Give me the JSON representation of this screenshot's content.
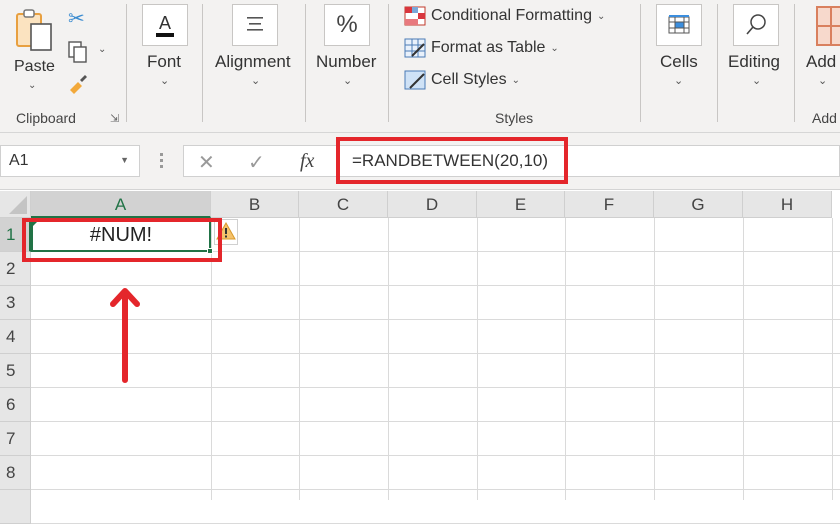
{
  "ribbon": {
    "groups": [
      {
        "name": "Clipboard",
        "buttons": [
          "Paste"
        ]
      },
      {
        "name": "Font",
        "label": "Font"
      },
      {
        "name": "Alignment",
        "label": "Alignment"
      },
      {
        "name": "Number",
        "label": "Number"
      },
      {
        "name": "Styles",
        "items": [
          "Conditional Formatting",
          "Format as Table",
          "Cell Styles"
        ]
      },
      {
        "name": "Cells",
        "label": "Cells"
      },
      {
        "name": "Editing",
        "label": "Editing"
      },
      {
        "name": "Add",
        "label": "Add"
      }
    ],
    "clipboard_label": "Clipboard",
    "paste_label": "Paste",
    "font_label": "Font",
    "alignment_label": "Alignment",
    "number_label": "Number",
    "cond_format_label": "Conditional Formatting",
    "format_table_label": "Format as Table",
    "cell_styles_label": "Cell Styles",
    "styles_label": "Styles",
    "cells_label": "Cells",
    "editing_label": "Editing",
    "addins_label": "Add",
    "addins_group_label": "Add"
  },
  "formula_bar": {
    "name_box": "A1",
    "cancel_icon": "✕",
    "enter_icon": "✓",
    "fx_icon": "fx",
    "formula": "=RANDBETWEEN(20,10)"
  },
  "sheet": {
    "columns": [
      "A",
      "B",
      "C",
      "D",
      "E",
      "F",
      "G",
      "H"
    ],
    "rows": [
      "1",
      "2",
      "3",
      "4",
      "5",
      "6",
      "7",
      "8"
    ],
    "active_cell": "A1",
    "cells": {
      "A1": "#NUM!"
    }
  },
  "annotations": {
    "highlight_color": "#e4262b",
    "accent_green": "#217346"
  }
}
